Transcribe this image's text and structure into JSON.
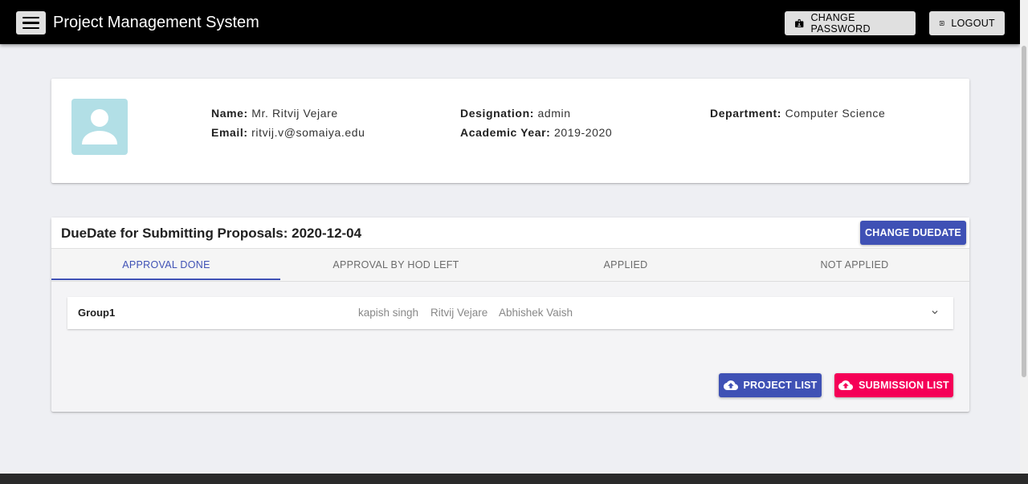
{
  "appbar": {
    "title": "Project Management System",
    "change_password_label": "CHANGE PASSWORD",
    "logout_label": "LOGOUT"
  },
  "profile": {
    "name_label": "Name:",
    "name": "Mr. Ritvij Vejare",
    "email_label": "Email:",
    "email": "ritvij.v@somaiya.edu",
    "designation_label": "Designation:",
    "designation": "admin",
    "academic_year_label": "Academic Year:",
    "academic_year": "2019-2020",
    "department_label": "Department:",
    "department": "Computer Science"
  },
  "proposals": {
    "due_title": "DueDate for Submitting Proposals: 2020-12-04",
    "change_due_label": "CHANGE DUEDATE",
    "tabs": [
      {
        "label": "APPROVAL DONE",
        "active": true
      },
      {
        "label": "APPROVAL BY HOD LEFT",
        "active": false
      },
      {
        "label": "APPLIED",
        "active": false
      },
      {
        "label": "NOT APPLIED",
        "active": false
      }
    ],
    "groups": [
      {
        "name": "Group1",
        "members": [
          "kapish singh",
          "Ritvij Vejare",
          "Abhishek Vaish"
        ]
      }
    ],
    "project_list_label": "PROJECT LIST",
    "submission_list_label": "SUBMISSION LIST"
  },
  "colors": {
    "primary": "#3f51b5",
    "secondary": "#f50057",
    "appbar": "#000000",
    "avatar_bg": "#b2dfe6"
  }
}
